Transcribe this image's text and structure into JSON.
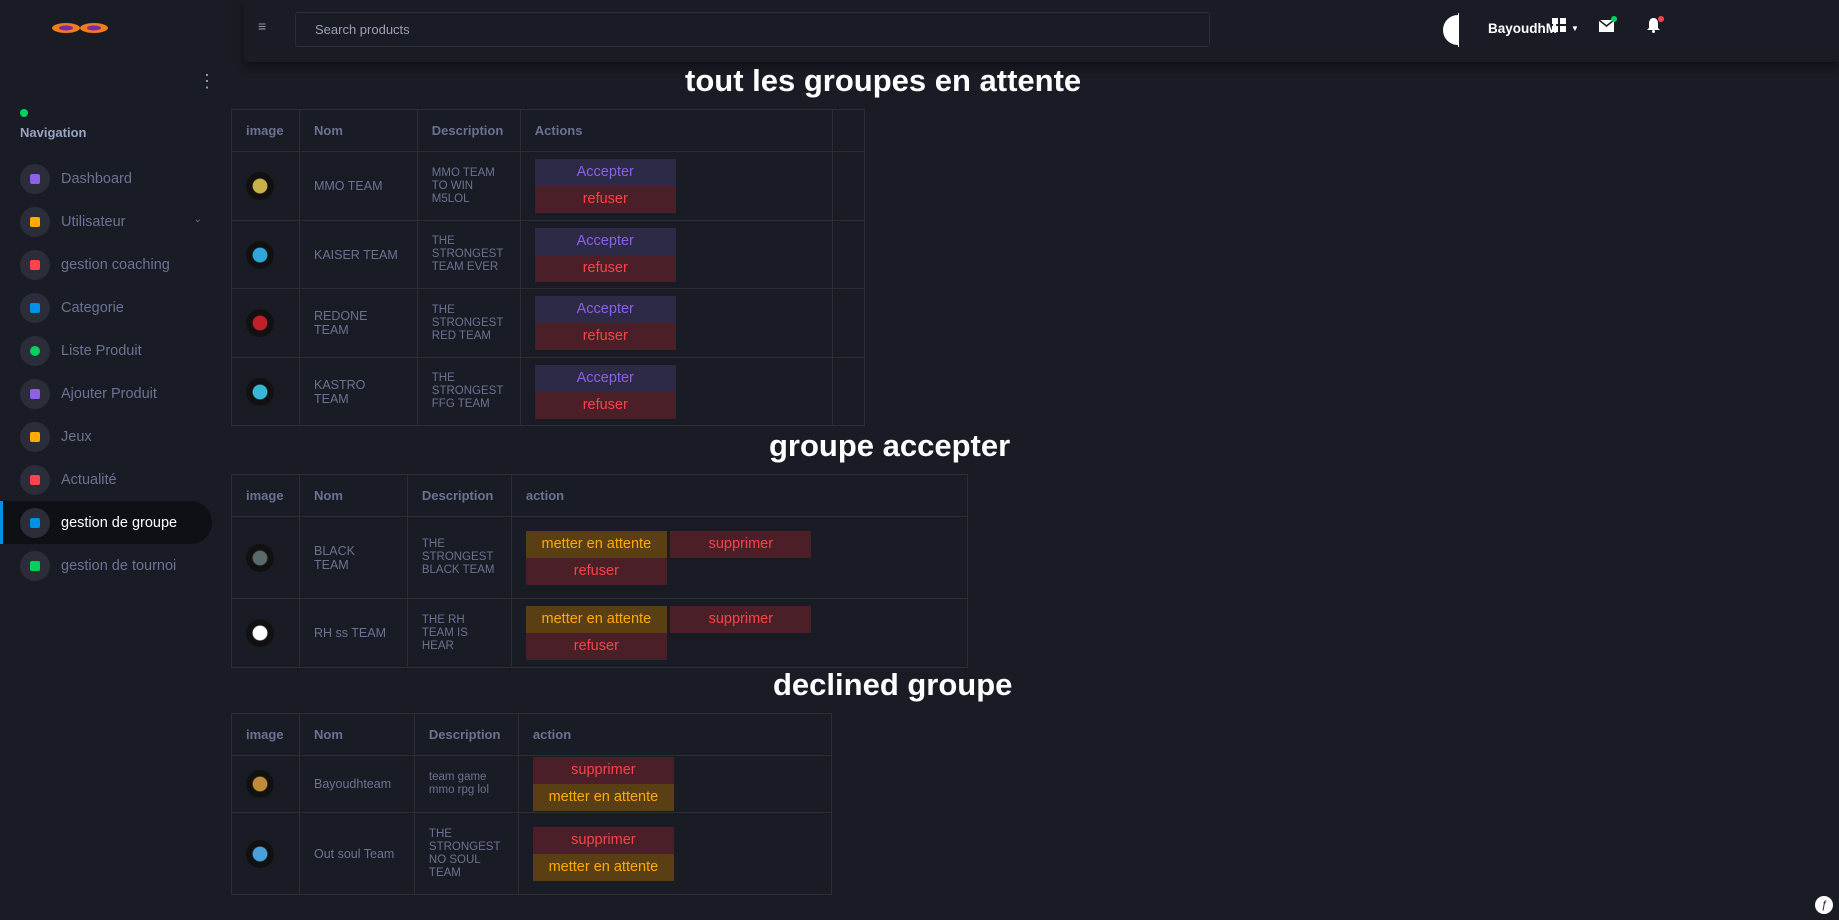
{
  "topbar": {
    "search_placeholder": "Search products",
    "username": "BayoudhM"
  },
  "sidebar": {
    "nav_title": "Navigation",
    "items": [
      {
        "label": "Dashboard",
        "icon": "speedometer-icon",
        "color": "#8f5fe8"
      },
      {
        "label": "Utilisateur",
        "icon": "users-icon",
        "color": "#ffab00"
      },
      {
        "label": "gestion coaching",
        "icon": "chart-icon",
        "color": "#fc424a"
      },
      {
        "label": "Categorie",
        "icon": "copy-icon",
        "color": "#0090e7"
      },
      {
        "label": "Liste Produit",
        "icon": "circle-icon",
        "color": "#00d25b"
      },
      {
        "label": "Ajouter Produit",
        "icon": "message-icon",
        "color": "#8f5fe8"
      },
      {
        "label": "Jeux",
        "icon": "gamepad-icon",
        "color": "#ffab00"
      },
      {
        "label": "Actualité",
        "icon": "news-icon",
        "color": "#fc424a"
      },
      {
        "label": "gestion de groupe",
        "icon": "chart-icon",
        "color": "#0090e7"
      },
      {
        "label": "gestion de tournoi",
        "icon": "chart-icon",
        "color": "#00d25b"
      }
    ]
  },
  "pending": {
    "title": "tout les groupes en attente",
    "headers": [
      "image",
      "Nom",
      "Description",
      "Actions"
    ],
    "accept_label": "Accepter",
    "refuse_label": "refuser",
    "rows": [
      {
        "name": "MMO TEAM",
        "desc": "MMO TEAM TO WIN M5LOL",
        "img_color": "#c9b24a"
      },
      {
        "name": "KAISER TEAM",
        "desc": "THE STRONGEST TEAM EVER",
        "img_color": "#2fa7d8"
      },
      {
        "name": "REDONE TEAM",
        "desc": "THE STRONGEST RED TEAM",
        "img_color": "#c0202a"
      },
      {
        "name": "KASTRO TEAM",
        "desc": "THE STRONGEST FFG TEAM",
        "img_color": "#39b5d8"
      }
    ]
  },
  "accepted": {
    "title": "groupe accepter",
    "headers": [
      "image",
      "Nom",
      "Description",
      "action"
    ],
    "wait_label": "metter en attente",
    "delete_label": "supprimer",
    "refuse_label": "refuser",
    "rows": [
      {
        "name": "BLACK TEAM",
        "desc": "THE STRONGEST BLACK TEAM",
        "img_color": "#5a6a6a"
      },
      {
        "name": "RH ss TEAM",
        "desc": "THE RH TEAM IS HEAR",
        "img_color": "#ffffff"
      }
    ]
  },
  "declined": {
    "title": "declined groupe",
    "headers": [
      "image",
      "Nom",
      "Description",
      "action"
    ],
    "delete_label": "supprimer",
    "wait_label": "metter en attente",
    "rows": [
      {
        "name": "Bayoudhteam",
        "desc": "team game mmo rpg lol",
        "img_color": "#c08a3a"
      },
      {
        "name": "Out soul Team",
        "desc": "THE STRONGEST NO SOUL TEAM",
        "img_color": "#4aa0d8"
      }
    ]
  }
}
